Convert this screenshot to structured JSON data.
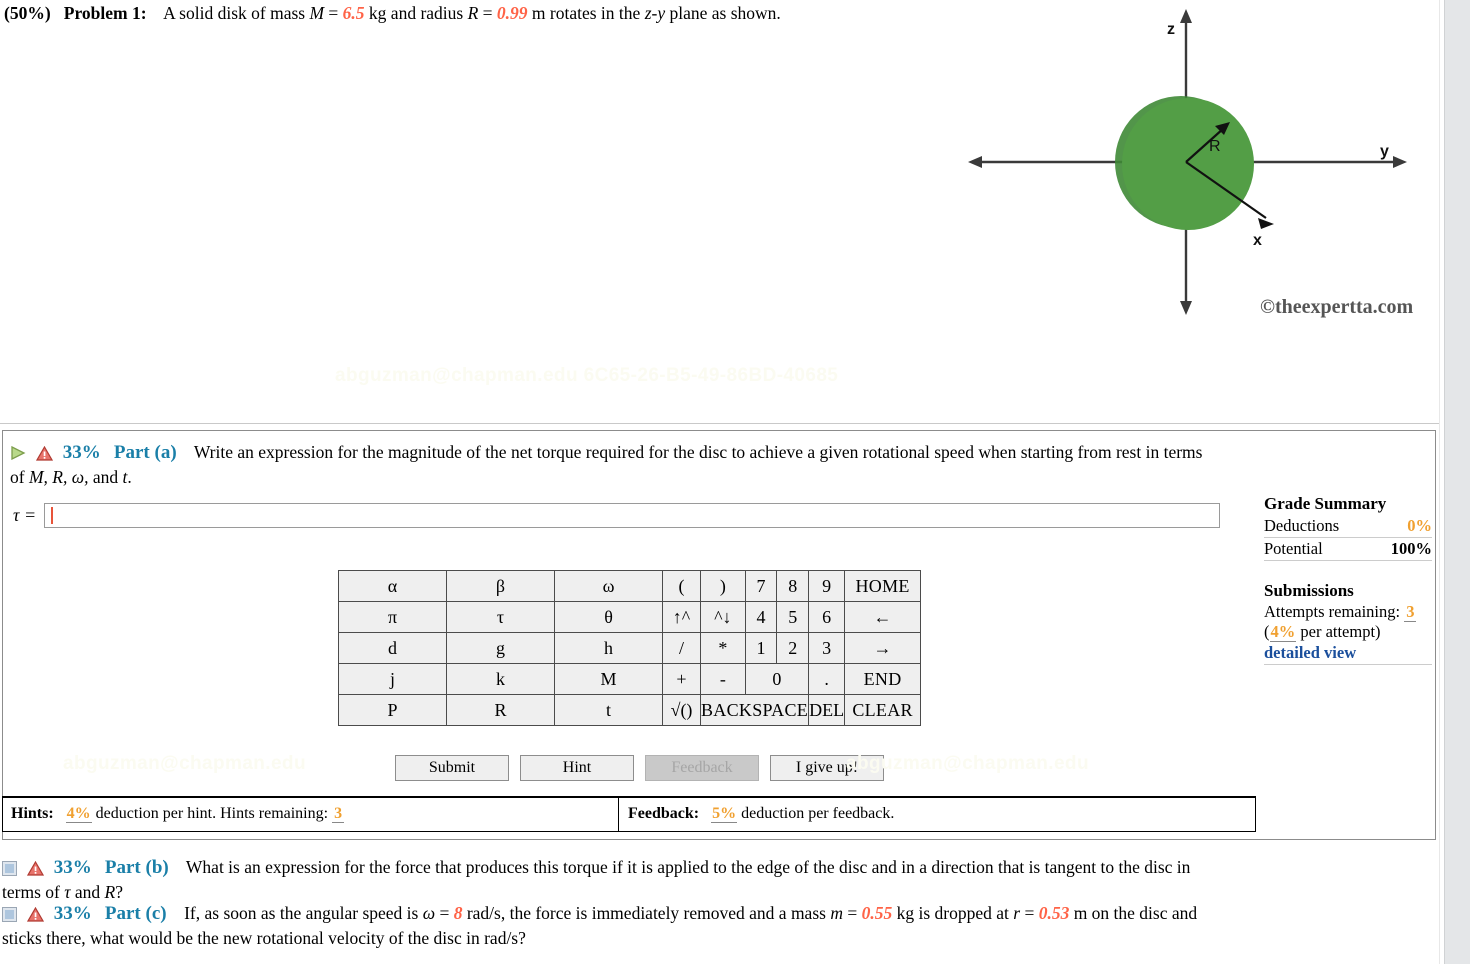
{
  "problem": {
    "weight": "(50%)",
    "label": "Problem 1:",
    "text_1": "A solid disk of mass ",
    "var_M": "M",
    "eq1": " = ",
    "val_M": "6.5",
    "text_2": " kg and radius ",
    "var_R": "R",
    "eq2": " = ",
    "val_R": "0.99",
    "text_3": " m rotates in the ",
    "plane": "z-y",
    "text_4": " plane as shown."
  },
  "figure": {
    "axis_z": "z",
    "axis_y": "y",
    "axis_x": "x",
    "radius_label": "R",
    "copyright": "©theexpertta.com",
    "disk_color": "#4f9e42"
  },
  "watermark": {
    "full": "abguzman@chapman.edu 6C65-26-B5-49-86BD-40685",
    "email": "abguzman@chapman.edu"
  },
  "part_a": {
    "percent": "33%",
    "name": "Part (a)",
    "prompt_line1": "Write an expression for the magnitude of the net torque required for the disc to achieve a given rotational speed when starting from rest in terms",
    "prompt_line2_pre": "of ",
    "prompt_vars": "M, R, ω,",
    "prompt_line2_post": " and ",
    "prompt_var_last": "t",
    "prompt_end": ".",
    "answer_var": "τ =",
    "answer_value": "",
    "answer_placeholder": ""
  },
  "keypad": {
    "rows": [
      [
        {
          "label": "α",
          "kind": "sym",
          "disabled": false
        },
        {
          "label": "β",
          "kind": "sym",
          "disabled": false
        },
        {
          "label": "ω",
          "kind": "sym",
          "disabled": false
        },
        {
          "label": "(",
          "kind": "op",
          "disabled": false
        },
        {
          "label": ")",
          "kind": "op",
          "disabled": true
        },
        {
          "label": "7",
          "kind": "num",
          "disabled": false
        },
        {
          "label": "8",
          "kind": "num",
          "disabled": false
        },
        {
          "label": "9",
          "kind": "num",
          "disabled": false
        },
        {
          "label": "HOME",
          "kind": "fn",
          "disabled": true
        }
      ],
      [
        {
          "label": "π",
          "kind": "sym",
          "disabled": false
        },
        {
          "label": "τ",
          "kind": "sym",
          "disabled": false
        },
        {
          "label": "θ",
          "kind": "sym",
          "disabled": false
        },
        {
          "label": "↑^",
          "kind": "op",
          "disabled": true
        },
        {
          "label": "^↓",
          "kind": "op",
          "disabled": true
        },
        {
          "label": "4",
          "kind": "num",
          "disabled": false
        },
        {
          "label": "5",
          "kind": "num",
          "disabled": false
        },
        {
          "label": "6",
          "kind": "num",
          "disabled": false
        },
        {
          "label": "←",
          "kind": "fn",
          "disabled": true
        }
      ],
      [
        {
          "label": "d",
          "kind": "sym",
          "disabled": false
        },
        {
          "label": "g",
          "kind": "sym",
          "disabled": false
        },
        {
          "label": "h",
          "kind": "sym",
          "disabled": false
        },
        {
          "label": "/",
          "kind": "op",
          "disabled": true
        },
        {
          "label": "*",
          "kind": "op",
          "disabled": true
        },
        {
          "label": "1",
          "kind": "num",
          "disabled": false
        },
        {
          "label": "2",
          "kind": "num",
          "disabled": false
        },
        {
          "label": "3",
          "kind": "num",
          "disabled": false
        },
        {
          "label": "→",
          "kind": "fn",
          "disabled": true
        }
      ],
      [
        {
          "label": "j",
          "kind": "sym",
          "disabled": false
        },
        {
          "label": "k",
          "kind": "sym",
          "disabled": false
        },
        {
          "label": "M",
          "kind": "sym",
          "disabled": false
        },
        {
          "label": "+",
          "kind": "op",
          "disabled": false
        },
        {
          "label": "-",
          "kind": "op",
          "disabled": false
        },
        {
          "label": "0",
          "kind": "num2",
          "disabled": false
        },
        {
          "label": ".",
          "kind": "num",
          "disabled": false
        },
        {
          "label": "END",
          "kind": "fn",
          "disabled": true
        }
      ],
      [
        {
          "label": "P",
          "kind": "sym",
          "disabled": false
        },
        {
          "label": "R",
          "kind": "sym",
          "disabled": false
        },
        {
          "label": "t",
          "kind": "sym",
          "disabled": false
        },
        {
          "label": "√()",
          "kind": "op",
          "disabled": false
        },
        {
          "label": "BACKSPACE",
          "kind": "bksp",
          "disabled": true
        },
        {
          "label": "DEL",
          "kind": "del",
          "disabled": true
        },
        {
          "label": "CLEAR",
          "kind": "fn",
          "disabled": true
        }
      ]
    ]
  },
  "buttons": {
    "submit": "Submit",
    "hint": "Hint",
    "feedback": "Feedback",
    "give_up": "I give up!"
  },
  "hints_bar": {
    "hints_label": "Hints:",
    "hints_pct": "4%",
    "hints_text": " deduction per hint. Hints remaining: ",
    "hints_remaining": "3",
    "feedback_label": "Feedback:",
    "feedback_pct": "5%",
    "feedback_text": " deduction per feedback."
  },
  "grade_summary": {
    "title": "Grade Summary",
    "deductions_label": "Deductions",
    "deductions_value": "0%",
    "potential_label": "Potential",
    "potential_value": "100%",
    "submissions_title": "Submissions",
    "attempts_label": "Attempts remaining:",
    "attempts_value": "3",
    "per_attempt_open": "(",
    "per_attempt_pct": "4%",
    "per_attempt_close": " per attempt)",
    "detailed_view": "detailed view"
  },
  "part_b": {
    "percent": "33%",
    "name": "Part (b)",
    "prompt_line1": "What is an expression for the force that produces this torque if it is applied to the edge of the disc and in a direction that is tangent to the disc in",
    "prompt_line2_pre": "terms of ",
    "prompt_var1": "τ",
    "prompt_mid": " and ",
    "prompt_var2": "R",
    "prompt_end": "?"
  },
  "part_c": {
    "percent": "33%",
    "name": "Part (c)",
    "seg_1": "If, as soon as the angular speed is ",
    "var_w": "ω",
    "eq1": " = ",
    "val_w": "8",
    "seg_2": " rad/s, the force is immediately removed and a mass ",
    "var_m": "m",
    "eq2": " = ",
    "val_m": "0.55",
    "seg_3": " kg is dropped at ",
    "var_r": "r",
    "eq3": " = ",
    "val_r": "0.53",
    "seg_4": " m on the disc and",
    "line2": "sticks there, what would be the new rotational velocity of the disc in rad/s?"
  },
  "colors": {
    "accent_teal": "#1a7fa8",
    "value_red": "#ff6347",
    "orange": "#f0a030",
    "link_blue": "#1b4f9c",
    "disk_green": "#4f9e42"
  }
}
